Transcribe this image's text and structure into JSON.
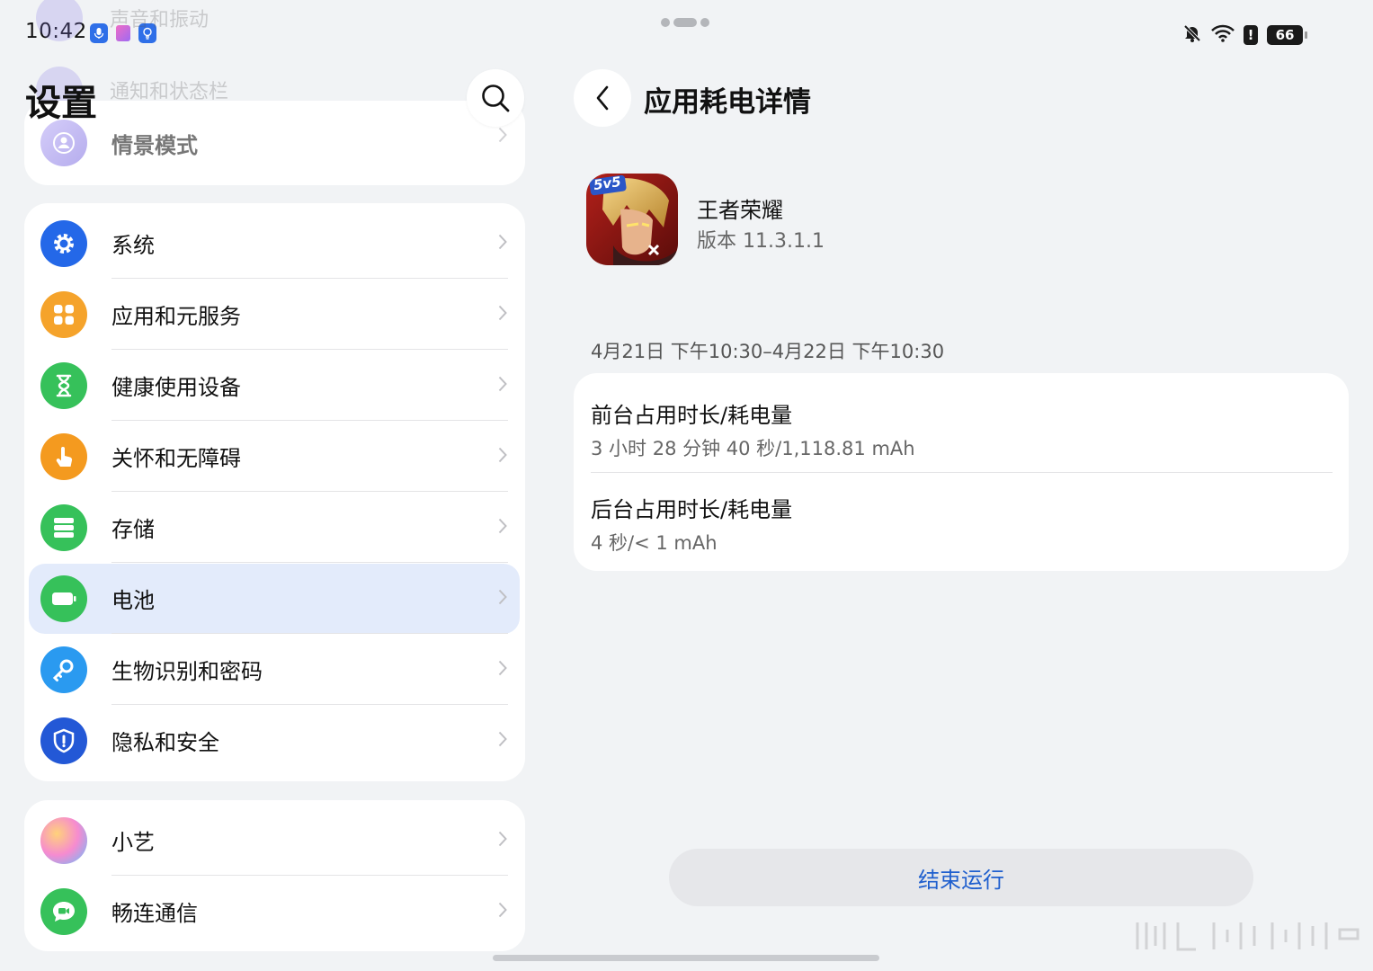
{
  "status_bar": {
    "time": "10:42",
    "battery": "66",
    "alert": "!"
  },
  "left": {
    "title": "设置",
    "faded_items": [
      "声音和振动",
      "通知和状态栏"
    ],
    "top_item": {
      "label": "情景模式",
      "icon": "profile-icon",
      "color": "#8a7ae6"
    },
    "items": [
      {
        "label": "系统",
        "icon": "gear-icon",
        "color": "#2468e8"
      },
      {
        "label": "应用和元服务",
        "icon": "apps-grid-icon",
        "color": "#f5a32b"
      },
      {
        "label": "健康使用设备",
        "icon": "hourglass-icon",
        "color": "#36c15a"
      },
      {
        "label": "关怀和无障碍",
        "icon": "hand-pointer-icon",
        "color": "#f49a1f"
      },
      {
        "label": "存储",
        "icon": "storage-icon",
        "color": "#36c15a"
      },
      {
        "label": "电池",
        "icon": "battery-icon",
        "color": "#36c15a",
        "selected": true
      },
      {
        "label": "生物识别和密码",
        "icon": "key-icon",
        "color": "#2a9af0"
      },
      {
        "label": "隐私和安全",
        "icon": "shield-icon",
        "color": "#2358d6"
      }
    ],
    "bottom_items": [
      {
        "label": "小艺",
        "icon": "celia-icon",
        "color": "#f0a4d8"
      },
      {
        "label": "畅连通信",
        "icon": "message-video-icon",
        "color": "#36c15a"
      }
    ]
  },
  "right": {
    "title": "应用耗电详情",
    "app": {
      "name": "王者荣耀",
      "version": "版本 11.3.1.1",
      "badge": "5v5"
    },
    "range": "4月21日 下午10:30–4月22日 下午10:30",
    "foreground": {
      "label": "前台占用时长/耗电量",
      "value": "3 小时 28 分钟 40 秒/1,118.81 mAh"
    },
    "background": {
      "label": "后台占用时长/耗电量",
      "value": "4 秒/< 1 mAh"
    },
    "end_button": "结束运行"
  }
}
